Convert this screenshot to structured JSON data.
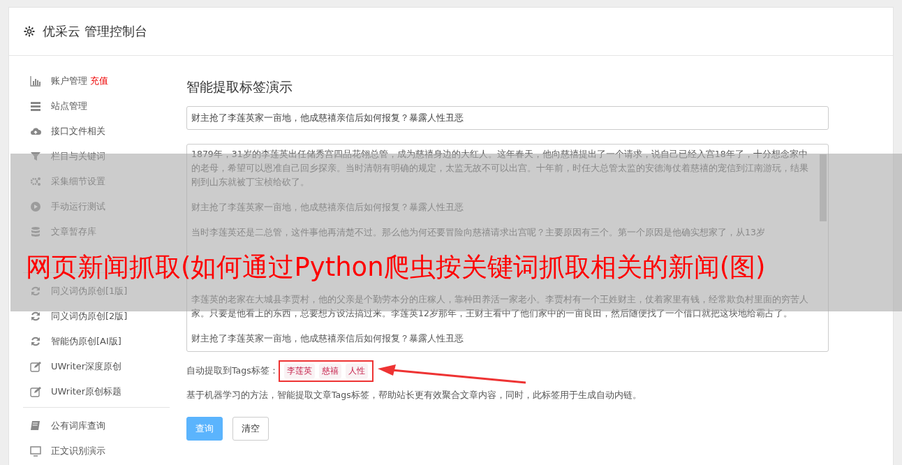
{
  "header": {
    "title": "优采云 管理控制台"
  },
  "sidebar": {
    "groups": [
      {
        "items": [
          {
            "kind": "chart",
            "label": "账户管理",
            "badge": "充值"
          },
          {
            "kind": "server",
            "label": "站点管理"
          },
          {
            "kind": "cloud",
            "label": "接口文件相关"
          },
          {
            "kind": "filter",
            "label": "栏目与关键词"
          },
          {
            "kind": "gears",
            "label": "采集细节设置"
          },
          {
            "kind": "play",
            "label": "手动运行测试"
          },
          {
            "kind": "database",
            "label": "文章暂存库"
          }
        ]
      },
      {
        "items": [
          {
            "kind": "refresh",
            "label": "同义词伪原创[1版]"
          },
          {
            "kind": "refresh",
            "label": "同义词伪原创[2版]"
          },
          {
            "kind": "refresh",
            "label": "智能伪原创[AI版]"
          },
          {
            "kind": "edit",
            "label": "UWriter深度原创"
          },
          {
            "kind": "edit",
            "label": "UWriter原创标题"
          }
        ]
      },
      {
        "items": [
          {
            "kind": "book",
            "label": "公有词库查询"
          },
          {
            "kind": "monitor",
            "label": "正文识别演示"
          }
        ]
      }
    ]
  },
  "main": {
    "heading": "智能提取标签演示",
    "title_value": "财主抢了李莲英家一亩地，他成慈禧亲信后如何报复？暴露人性丑恶",
    "body_paragraphs": [
      {
        "kind": "text",
        "text": "1879年，31岁的李莲英出任储秀宫四品花翎总管，成为慈禧身边的大红人。这年春天，他向慈禧提出了一个请求，说自己已经入宫18年了，十分想念家中的老母，希望可以恩准自己回乡探亲。当时清朝有明确的规定，太监无故不可以出宫。十年前，时任大总管太监的安德海仗着慈禧的宠信到江南游玩，结果刚到山东就被丁宝桢给砍了。"
      },
      {
        "kind": "text",
        "text": "财主抢了李莲英家一亩地，他成慈禧亲信后如何报复？暴露人性丑恶"
      },
      {
        "kind": "covered",
        "text": "当时李莲英还是二总管，这件事他再清楚不过。那么他为何还要冒险向慈禧请求出宫呢？主要原因有三个。第一个原因是他确实想家了，从13岁"
      },
      {
        "kind": "text",
        "text": "李莲英的老家在大城县李贾村，他的父亲是个勤劳本分的庄稼人，靠种田养活一家老小。李贾村有一个王姓财主，仗着家里有钱，经常欺负村里面的穷苦人家。只要是他看上的东西，总要想方设法搞过来。李莲英12岁那年，王财主看中了他们家中的一亩良田，然后随便找了一个借口就把这块地给霸占了。"
      },
      {
        "kind": "text",
        "text": "财主抢了李莲英家一亩地，他成慈禧亲信后如何报复？暴露人性丑恶"
      }
    ],
    "tags_label": "自动提取到Tags标签：",
    "tags": [
      "李莲英",
      "慈禧",
      "人性"
    ],
    "note": "基于机器学习的方法，智能提取文章Tags标签，帮助站长更有效聚合文章内容，同时，此标签用于生成自动内链。",
    "buttons": [
      {
        "label": "查询",
        "kind": "primary"
      },
      {
        "label": "清空",
        "kind": "default"
      }
    ]
  },
  "overlay_banner": {
    "title": "网页新闻抓取(如何通过Python爬虫按关键词抓取相关的新闻(图)"
  }
}
